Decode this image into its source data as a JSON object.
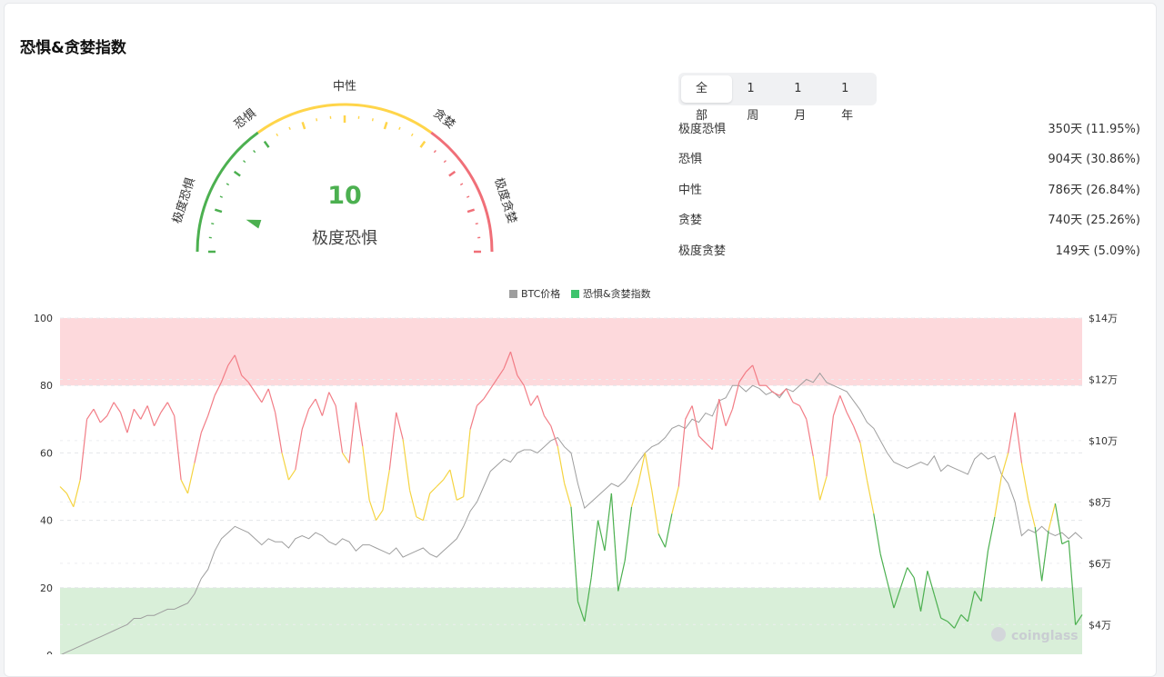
{
  "header": {
    "title": "恐惧&贪婪指数"
  },
  "gauge": {
    "value": "10",
    "status": "极度恐惧",
    "labels": {
      "extreme_fear": "极度恐惧",
      "fear": "恐惧",
      "neutral": "中性",
      "greed": "贪婪",
      "extreme_greed": "极度贪婪"
    },
    "colors": {
      "fear": "#4cb050",
      "neutral": "#ffd54a",
      "greed": "#f06f78"
    }
  },
  "tabs": [
    {
      "label": "全部",
      "active": true
    },
    {
      "label": "1周",
      "active": false
    },
    {
      "label": "1月",
      "active": false
    },
    {
      "label": "1年",
      "active": false
    }
  ],
  "stats": [
    {
      "label": "极度恐惧",
      "value": "350天 (11.95%)"
    },
    {
      "label": "恐惧",
      "value": "904天 (30.86%)"
    },
    {
      "label": "中性",
      "value": "786天 (26.84%)"
    },
    {
      "label": "贪婪",
      "value": "740天 (25.26%)"
    },
    {
      "label": "极度贪婪",
      "value": "149天 (5.09%)"
    }
  ],
  "chart_data": {
    "type": "line",
    "legend": [
      "BTC价格",
      "恐惧&贪婪指数"
    ],
    "legend_placement": "top-center",
    "y_left": {
      "range": [
        0,
        100
      ],
      "ticks": [
        "100",
        "80",
        "60",
        "40",
        "20",
        "0"
      ]
    },
    "y_right": {
      "range": [
        30000,
        140000
      ],
      "ticks": [
        "$14万",
        "$12万",
        "$10万",
        "$8万",
        "$6万",
        "$4万"
      ]
    },
    "zones": [
      {
        "name": "greed-zone",
        "from": 80,
        "to": 100,
        "color": "#fdd9dc"
      },
      {
        "name": "fear-zone",
        "from": 0,
        "to": 20,
        "color": "#d9efd9"
      }
    ],
    "series": [
      {
        "name": "恐惧&贪婪指数",
        "values": [
          50,
          48,
          44,
          52,
          70,
          73,
          69,
          71,
          75,
          72,
          66,
          73,
          70,
          74,
          68,
          72,
          75,
          71,
          52,
          48,
          57,
          66,
          71,
          77,
          81,
          86,
          89,
          83,
          81,
          78,
          75,
          79,
          72,
          60,
          52,
          55,
          67,
          73,
          76,
          71,
          78,
          74,
          60,
          57,
          75,
          62,
          46,
          40,
          43,
          55,
          72,
          64,
          49,
          41,
          40,
          48,
          50,
          52,
          55,
          46,
          47,
          67,
          74,
          76,
          79,
          82,
          85,
          90,
          83,
          80,
          74,
          77,
          71,
          68,
          62,
          51,
          44,
          16,
          10,
          23,
          40,
          31,
          48,
          19,
          28,
          44,
          51,
          60,
          49,
          36,
          32,
          42,
          50,
          70,
          74,
          65,
          63,
          61,
          76,
          68,
          73,
          81,
          84,
          86,
          80,
          80,
          78,
          77,
          79,
          75,
          74,
          70,
          59,
          46,
          53,
          71,
          77,
          72,
          68,
          63,
          52,
          42,
          30,
          22,
          14,
          20,
          26,
          23,
          13,
          25,
          18,
          11,
          10,
          8,
          12,
          10,
          19,
          16,
          31,
          41,
          53,
          60,
          72,
          57,
          46,
          38,
          22,
          37,
          45,
          33,
          34,
          9,
          12
        ]
      },
      {
        "name": "BTC价格",
        "values": [
          30000,
          31000,
          32000,
          33000,
          34000,
          35000,
          36000,
          37000,
          38000,
          39000,
          40000,
          42000,
          42000,
          43000,
          43000,
          44000,
          45000,
          45000,
          46000,
          47000,
          50000,
          55000,
          58000,
          64000,
          68000,
          70000,
          72000,
          71000,
          70000,
          68000,
          66000,
          68000,
          67000,
          67000,
          65000,
          68000,
          69000,
          68000,
          70000,
          69000,
          67000,
          66000,
          68000,
          67000,
          64000,
          66000,
          66000,
          65000,
          64000,
          63000,
          65000,
          62000,
          63000,
          64000,
          65000,
          63000,
          62000,
          64000,
          66000,
          68000,
          72000,
          77000,
          80000,
          85000,
          90000,
          92000,
          94000,
          93000,
          96000,
          97000,
          97000,
          96000,
          98000,
          100000,
          101000,
          98000,
          96000,
          86000,
          78000,
          80000,
          82000,
          84000,
          86000,
          85000,
          87000,
          90000,
          93000,
          96000,
          98000,
          99000,
          101000,
          104000,
          105000,
          104000,
          107000,
          106000,
          109000,
          108000,
          113000,
          114000,
          118000,
          118000,
          116000,
          118000,
          117000,
          115000,
          116000,
          114000,
          117000,
          116000,
          118000,
          120000,
          119000,
          122000,
          119000,
          118000,
          117000,
          116000,
          113000,
          110000,
          106000,
          104000,
          100000,
          96000,
          93000,
          92000,
          91000,
          92000,
          93000,
          92000,
          95000,
          90000,
          92000,
          91000,
          90000,
          89000,
          94000,
          96000,
          94000,
          95000,
          89000,
          86000,
          80000,
          69000,
          71000,
          70000,
          72000,
          70000,
          69000,
          70000,
          68000,
          70000,
          68000
        ]
      }
    ]
  },
  "watermark": "coinglass"
}
